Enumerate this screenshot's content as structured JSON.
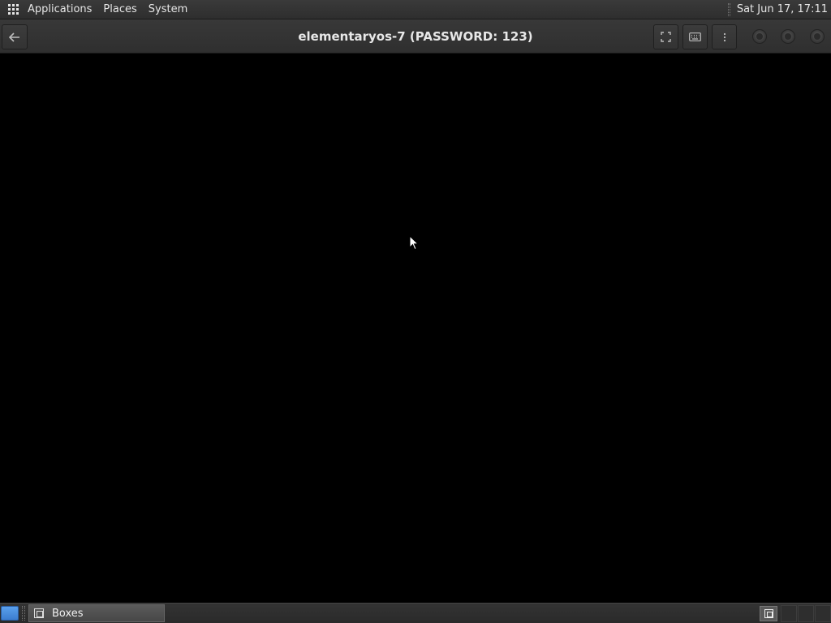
{
  "top_panel": {
    "menu": [
      "Applications",
      "Places",
      "System"
    ],
    "clock": "Sat Jun 17, 17:11"
  },
  "headerbar": {
    "title": "elementaryos-7 (PASSWORD: 123)"
  },
  "icons": {
    "back": "back-arrow-icon",
    "fullscreen": "fullscreen-icon",
    "keyboard": "keyboard-icon",
    "menu": "vertical-ellipsis-icon",
    "minimize": "minimize-icon",
    "maximize": "maximize-icon",
    "close": "close-icon"
  },
  "taskbar": {
    "tasks": [
      {
        "label": "Boxes"
      }
    ]
  },
  "colors": {
    "panel": "#2e2e2e",
    "display": "#000000",
    "show_desktop": "#3b7dd0"
  }
}
